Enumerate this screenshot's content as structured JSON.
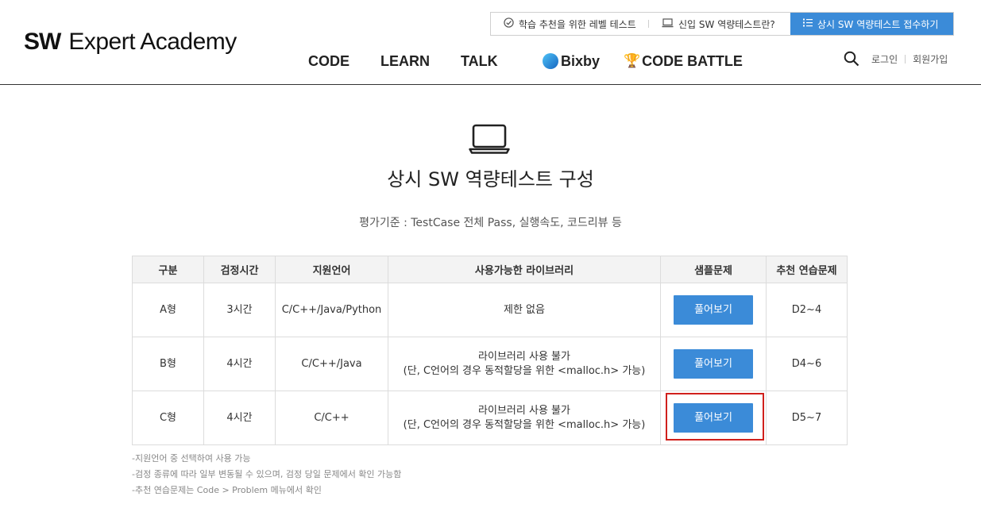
{
  "header": {
    "logo_sw": "SW",
    "logo_rest": "Expert Academy",
    "top_links": [
      {
        "label": "학습 추천을 위한 레벨 테스트"
      },
      {
        "label": "신입 SW 역량테스트란?"
      },
      {
        "label": "상시 SW 역량테스트 접수하기"
      }
    ],
    "nav": {
      "code": "CODE",
      "learn": "LEARN",
      "talk": "TALK",
      "bixby": "Bixby",
      "code_battle": "CODE BATTLE"
    },
    "login": "로그인",
    "signup": "회원가입"
  },
  "main": {
    "title": "상시 SW 역량테스트 구성",
    "criteria": "평가기준 : TestCase 전체 Pass, 실행속도, 코드리뷰 등"
  },
  "table": {
    "headers": [
      "구분",
      "검정시간",
      "지원언어",
      "사용가능한 라이브러리",
      "샘플문제",
      "추천 연습문제"
    ],
    "button_label": "풀어보기",
    "rows": [
      {
        "type": "A형",
        "time": "3시간",
        "lang": "C/C++/Java/Python",
        "lib_1": "제한 없음",
        "lib_2": "",
        "practice": "D2~4"
      },
      {
        "type": "B형",
        "time": "4시간",
        "lang": "C/C++/Java",
        "lib_1": "라이브러리 사용 불가",
        "lib_2": "(단, C언어의 경우 동적할당을 위한 <malloc.h> 가능)",
        "practice": "D4~6"
      },
      {
        "type": "C형",
        "time": "4시간",
        "lang": "C/C++",
        "lib_1": "라이브러리 사용 불가",
        "lib_2": "(단, C언어의 경우 동적할당을 위한 <malloc.h> 가능)",
        "practice": "D5~7"
      }
    ]
  },
  "notes": [
    "-지원언어 중 선택하여 사용 가능",
    "-검정 종류에 따라 일부 변동될 수 있으며, 검정 당일 문제에서 확인 가능함",
    "-추천 연습문제는 Code > Problem 메뉴에서 확인"
  ],
  "colors": {
    "accent": "#3b8bd8",
    "highlight": "#d0201c",
    "header_border": "#333333"
  },
  "icons": {
    "level_test": "check-circle-icon",
    "sw_test_info": "laptop-icon",
    "apply": "list-icon",
    "search": "search-icon",
    "hero": "laptop-icon",
    "bixby": "bixby-logo-icon",
    "battle": "trophy-icon"
  }
}
